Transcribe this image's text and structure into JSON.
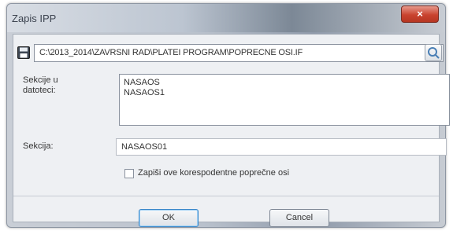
{
  "window": {
    "title": "Zapis IPP",
    "close_label": "×"
  },
  "path": {
    "value": "C:\\2013_2014\\ZAVRSNI RAD\\PLATEI PROGRAM\\POPRECNE OSI.IF",
    "arrow": "▼"
  },
  "sections_in_file": {
    "label_line1": "Sekcije u",
    "label_line2": "datoteci:",
    "items": [
      "NASAOS",
      "NASAOS1"
    ]
  },
  "section": {
    "label": "Sekcija:",
    "value": "NASAOS01"
  },
  "checkbox": {
    "label": "Zapiši ove korespodentne poprečne osi",
    "checked": false
  },
  "buttons": {
    "ok": "OK",
    "cancel": "Cancel"
  },
  "colors": {
    "close": "#c9432f",
    "focus": "#3a87c9"
  }
}
